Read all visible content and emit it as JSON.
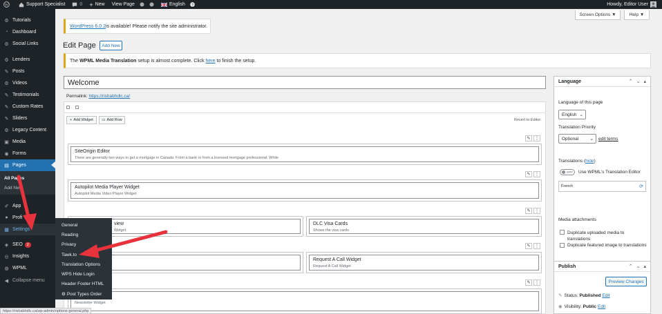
{
  "admin_bar": {
    "site_name": "Support Specialist",
    "comments_count": "0",
    "new_label": "New",
    "view_page_label": "View Page",
    "language": "English",
    "howdy": "Howdy, Editor User"
  },
  "sidebar": {
    "items": [
      {
        "label": "Tutorials",
        "icon": "gear-icon"
      },
      {
        "label": "Dashboard",
        "icon": "dashboard-icon"
      },
      {
        "label": "Social Links",
        "icon": "gear-icon"
      },
      {
        "label": "Lenders",
        "icon": "gear-icon"
      },
      {
        "label": "Posts",
        "icon": "pin-icon"
      },
      {
        "label": "Videos",
        "icon": "gear-icon"
      },
      {
        "label": "Testimonials",
        "icon": "pin-icon"
      },
      {
        "label": "Custom Rates",
        "icon": "pin-icon"
      },
      {
        "label": "Sliders",
        "icon": "pin-icon"
      },
      {
        "label": "Legacy Content",
        "icon": "gear-icon"
      },
      {
        "label": "Media",
        "icon": "media-icon"
      },
      {
        "label": "Forms",
        "icon": "forms-icon"
      },
      {
        "label": "Pages",
        "icon": "pages-icon"
      }
    ],
    "pages_sub": [
      "All Pages",
      "Add New"
    ],
    "appearance": "App",
    "profile": "Profi",
    "settings": "Settings",
    "seo": "SEO",
    "seo_badge": "2",
    "insights": "Insights",
    "wpml": "WPML",
    "collapse": "Collapse menu"
  },
  "settings_flyout": [
    "General",
    "Reading",
    "Privacy",
    "Tawk.to",
    "Translation Options",
    "WPS Hide Login",
    "Header Footer HTML",
    "Post Types Order"
  ],
  "top_buttons": {
    "screen_options": "Screen Options ▼",
    "help": "Help ▼"
  },
  "update_notice": {
    "link": "WordPress 6.0.2",
    "text": " is available! Please notify the site administrator."
  },
  "heading": {
    "title": "Edit Page",
    "add_new": "Add New"
  },
  "wpml_notice": {
    "pre": "The ",
    "bold": "WPML Media Translation",
    "mid": " setup is almost complete. Click ",
    "link": "here",
    "post": " to finish the setup."
  },
  "editor": {
    "title_value": "Welcome",
    "permalink_label": "Permalink: ",
    "permalink_url": "https://rishabhdlc.ca/",
    "add_widget": "Add Widget",
    "add_row": "Add Row",
    "revert": "Revert to Editor"
  },
  "widgets": [
    {
      "title": "SiteOrigin Editor",
      "desc": "There are generally two ways to get a mortgage in Canada: From a bank or from a licensed mortgage professional. While"
    },
    {
      "title": "Autopilot Media Player Widget",
      "desc": "Autopilot Media Video Player Widget"
    },
    {
      "title": "view",
      "desc": "Widget"
    },
    {
      "title": "DLC Visa Cards",
      "desc": "Shows the visa cards"
    },
    {
      "title": "",
      "desc": ""
    },
    {
      "title": "Request A Call Widget",
      "desc": "Request A Call Widget"
    },
    {
      "title": "",
      "desc": "Newsletter Widget"
    }
  ],
  "language_panel": {
    "title": "Language",
    "lang_of_page": "Language of this page",
    "lang_value": "English",
    "priority_label": "Translation Priority",
    "priority_value": "Optional",
    "edit_terms": "edit terms",
    "translations": "Translations (",
    "hide": "hide",
    "translations_end": ")",
    "toggle": "OFF",
    "use_editor": "Use WPML's Translation Editor",
    "french": "French",
    "media_attachments": "Media attachments",
    "dup_media": "Duplicate uploaded media to translations",
    "dup_featured": "Duplicate featured image to translations"
  },
  "publish_panel": {
    "title": "Publish",
    "preview": "Preview Changes",
    "status_label": "Status: ",
    "status_value": "Published",
    "edit": "Edit",
    "visibility_label": "Visibility: ",
    "visibility_value": "Public"
  },
  "status_bar": "https://rishabhdlc.ca/wp-admin/options-general.php",
  "colors": {
    "admin_bar": "#1d2327",
    "accent": "#2271b1",
    "annotation_arrow": "#e8333c"
  }
}
